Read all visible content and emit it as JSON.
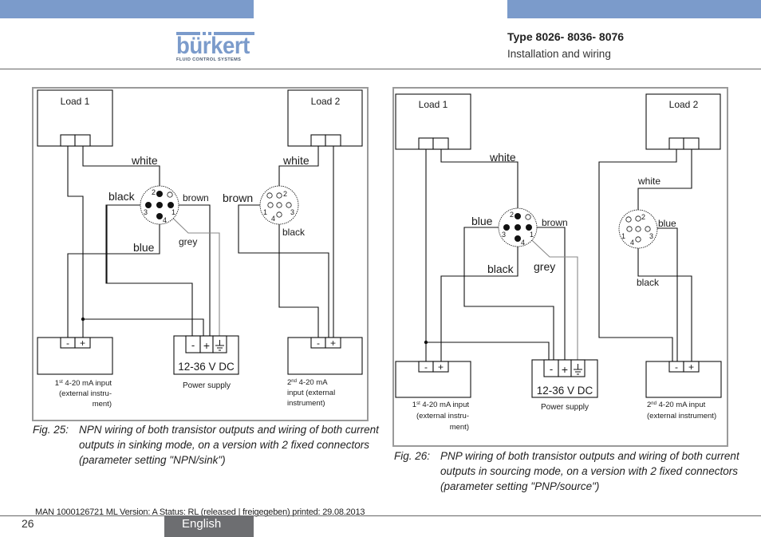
{
  "header": {
    "brand": {
      "name": "bürkert",
      "tagline": "FLUID CONTROL SYSTEMS",
      "color": "#7b9bcb"
    },
    "title": "Type 8026- 8036- 8076",
    "section": "Installation and wiring"
  },
  "figures": [
    {
      "id": "fig25",
      "mode": "NPN",
      "load1": "Load 1",
      "load2": "Load 2",
      "connector1": {
        "pins": [
          "2",
          "3",
          "1",
          "4"
        ],
        "wires": {
          "white": "white",
          "black": "black",
          "brown": "brown",
          "blue": "blue",
          "grey": "grey"
        }
      },
      "connector2": {
        "pins": [
          "2",
          "1",
          "3",
          "4"
        ],
        "wires": {
          "white": "white",
          "brown": "brown",
          "black": "black"
        }
      },
      "input1": {
        "minus": "-",
        "plus": "+",
        "label_sup": "st",
        "label_num": "1",
        "label_lines": [
          "4-20 mA input",
          "(external instru-",
          "ment)"
        ]
      },
      "power_supply": {
        "minus": "-",
        "plus": "+",
        "voltage": "12-36 V DC",
        "label": "Power supply"
      },
      "input2": {
        "minus": "-",
        "plus": "+",
        "label_sup": "nd",
        "label_num": "2",
        "label_lines": [
          "4-20 mA",
          "input (external",
          "instrument)"
        ]
      },
      "caption_label": "Fig. 25:",
      "caption_text": "NPN wiring of both transistor outputs and wiring of both current outputs in sinking mode, on a version with 2 fixed connectors (parameter setting \"NPN/sink\")"
    },
    {
      "id": "fig26",
      "mode": "PNP",
      "load1": "Load 1",
      "load2": "Load 2",
      "connector1": {
        "pins": [
          "2",
          "3",
          "1",
          "4"
        ],
        "wires": {
          "white": "white",
          "blue": "blue",
          "brown": "brown",
          "black": "black",
          "grey": "grey"
        }
      },
      "connector2": {
        "pins": [
          "2",
          "1",
          "3",
          "4"
        ],
        "wires": {
          "white": "white",
          "blue": "blue",
          "black": "black"
        }
      },
      "input1": {
        "minus": "-",
        "plus": "+",
        "label_sup": "st",
        "label_num": "1",
        "label_lines": [
          "4-20 mA input",
          "(external instru-",
          "ment)"
        ]
      },
      "power_supply": {
        "minus": "-",
        "plus": "+",
        "voltage": "12-36 V DC",
        "label": "Power supply"
      },
      "input2": {
        "minus": "-",
        "plus": "+",
        "label_sup": "nd",
        "label_num": "2",
        "label_lines": [
          "4-20 mA input",
          "(external instrument)"
        ]
      },
      "caption_label": "Fig. 26:",
      "caption_text": "PNP wiring of both transistor outputs and wiring of both current outputs in sourcing mode, on a version with 2 fixed connectors (parameter setting \"PNP/source\")"
    }
  ],
  "footer": {
    "meta": "MAN  1000126721  ML  Version: A Status: RL (released | freigegeben)  printed: 29.08.2013",
    "page_number": "26",
    "language": "English"
  }
}
